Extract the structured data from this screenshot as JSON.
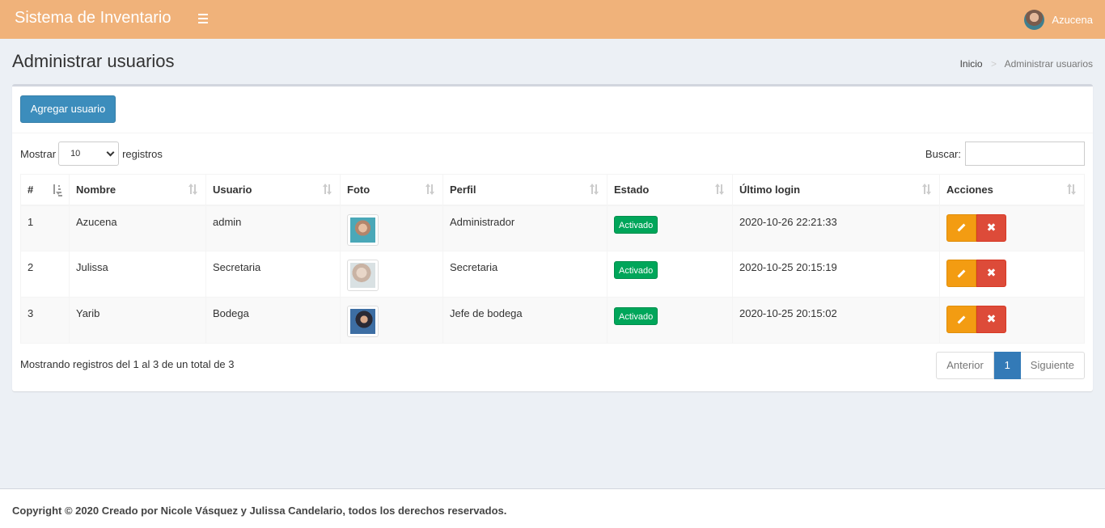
{
  "header": {
    "brand": "Sistema de Inventario",
    "user_name": "Azucena"
  },
  "page": {
    "title": "Administrar usuarios",
    "breadcrumb": [
      "Inicio",
      ">",
      "Administrar usuarios"
    ]
  },
  "toolbar": {
    "add_label": "Agregar usuario"
  },
  "table_controls": {
    "show_label": "Mostrar",
    "page_size": "10",
    "records_label": "registros",
    "search_label": "Buscar:"
  },
  "table": {
    "columns": [
      "#",
      "Nombre",
      "Usuario",
      "Foto",
      "Perfil",
      "Estado",
      "Último login",
      "Acciones"
    ],
    "rows": [
      {
        "num": "1",
        "nombre": "Azucena",
        "usuario": "admin",
        "perfil": "Administrador",
        "estado": "Activado",
        "login": "2020-10-26 22:21:33"
      },
      {
        "num": "2",
        "nombre": "Julissa",
        "usuario": "Secretaria",
        "perfil": "Secretaria",
        "estado": "Activado",
        "login": "2020-10-25 20:15:19"
      },
      {
        "num": "3",
        "nombre": "Yarib",
        "usuario": "Bodega",
        "perfil": "Jefe de bodega",
        "estado": "Activado",
        "login": "2020-10-25 20:15:02"
      }
    ]
  },
  "footer_info": "Mostrando registros del 1 al 3 de un total de 3",
  "pagination": {
    "prev": "Anterior",
    "current": "1",
    "next": "Siguiente"
  },
  "footer": {
    "copyright": "Copyright © 2020 Creado por Nicole Vásquez y Julissa Candelario, todos los derechos reservados."
  },
  "colors": {
    "header": "#f0b27a",
    "primary": "#3c8dbc",
    "success": "#00a65a",
    "warning": "#f39c12",
    "danger": "#dd4b39"
  }
}
